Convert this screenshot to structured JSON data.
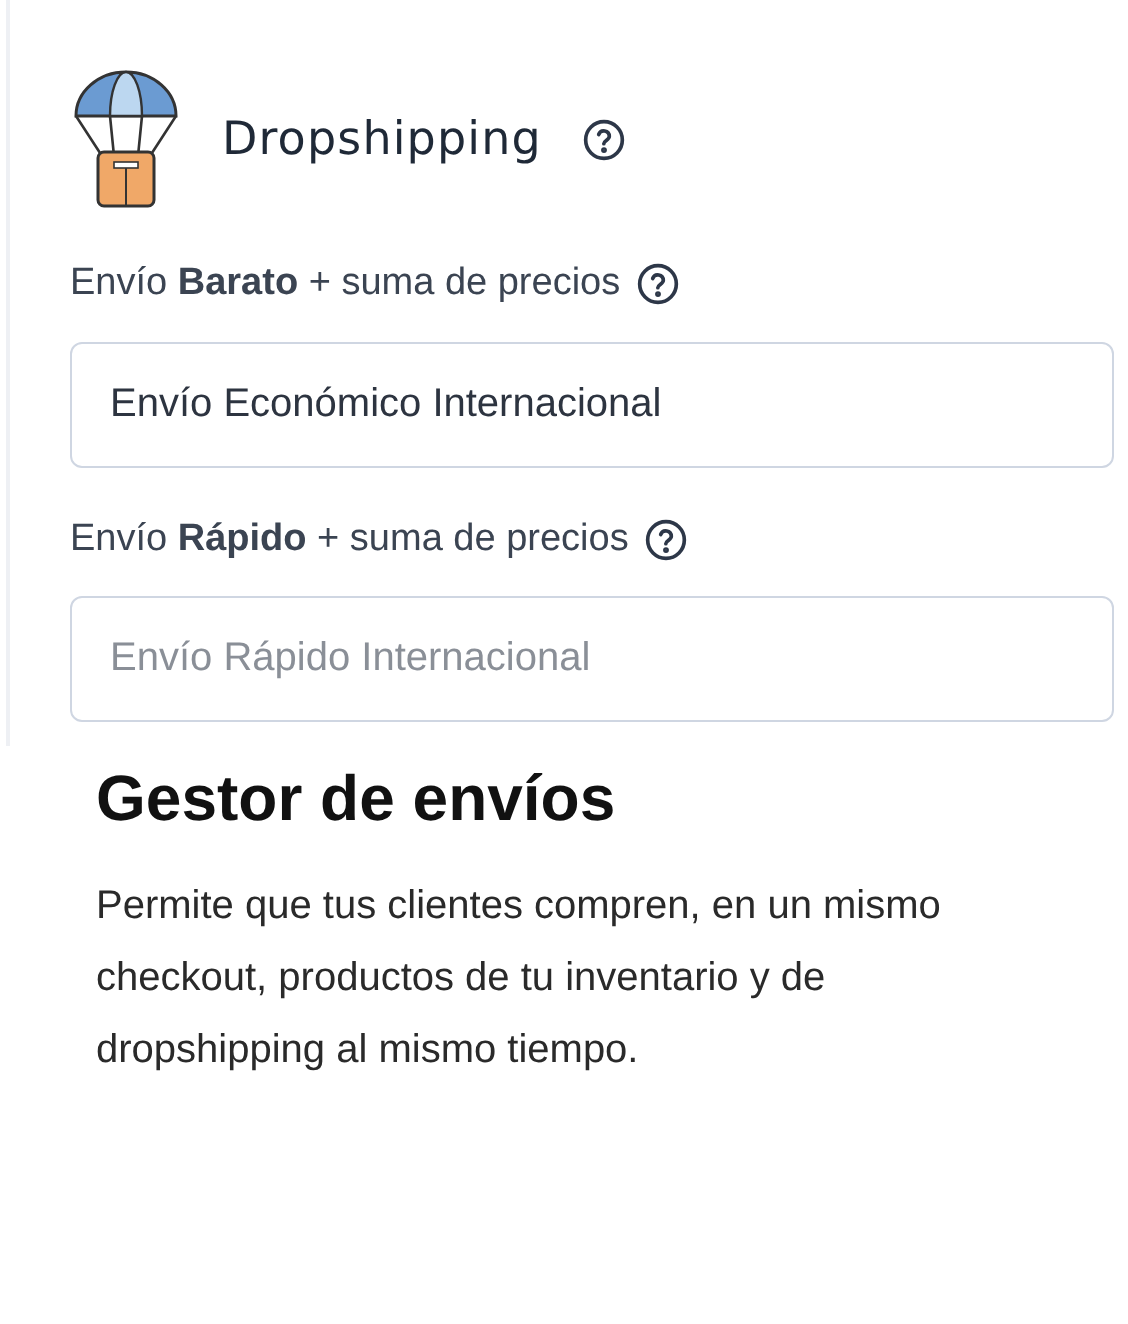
{
  "panel": {
    "title": "Dropshipping",
    "fields": [
      {
        "label": "Envío **Barato** + suma de precios",
        "value": "Envío Económico Internacional"
      },
      {
        "label": "Envío **Rápido** + suma de precios",
        "placeholder": "Envío Rápido Internacional"
      }
    ]
  },
  "feature": {
    "heading": "Gestor de envíos",
    "description": "Permite que tus clientes compren, en un mismo checkout, productos de tu inventario y de dropshipping al mismo tiempo."
  }
}
